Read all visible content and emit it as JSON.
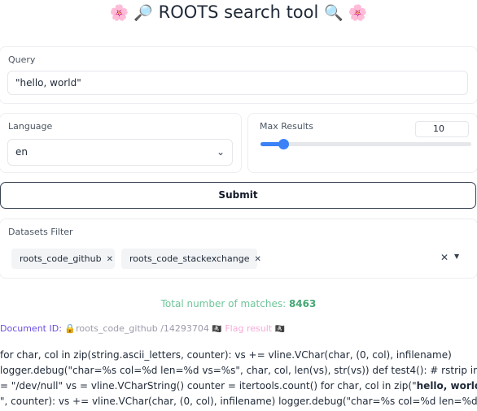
{
  "header": {
    "title": "ROOTS search tool",
    "left_emojis": "🌸 🔎",
    "right_emojis": "🔍 🌸"
  },
  "query": {
    "label": "Query",
    "value": "\"hello, world\""
  },
  "language": {
    "label": "Language",
    "selected": "en"
  },
  "max_results": {
    "label": "Max Results",
    "value": "10",
    "slider_fraction": 0.11
  },
  "submit_label": "Submit",
  "datasets_filter": {
    "label": "Datasets Filter",
    "chips": [
      "roots_code_github",
      "roots_code_stackexchange"
    ]
  },
  "results": {
    "total_label": "Total number of matches:",
    "total_count": "8463",
    "document_id_label": "Document ID:",
    "lock_emoji": "🔒",
    "document_dataset": "roots_code_github",
    "document_number": "/14293704",
    "flag_emoji": "🏴‍☠️",
    "flag_label": "Flag result",
    "snippet_lines": [
      "for char, col in zip(string.ascii_letters, counter): vs += vline.VChar(char, (0, col), infilename)",
      "logger.debug(\"char=%s col=%d len=%d vs=%s\", char, col, len(vs), str(vs)) def test4(): # rstrip infilename",
      "= \"/dev/null\" vs = vline.VCharString() counter = itertools.count() for char, col in zip(\"",
      "\", counter): vs += vline.VChar(char, (0, col), infilename) logger.debug(\"char=%s col=%d len=%d vs=%s\","
    ],
    "snippet_highlight": "hello, world"
  },
  "colors": {
    "accent_blue": "#3b82f6",
    "match_green": "#46a776",
    "doc_purple": "#6d4de1",
    "flag_pink": "#f7a8d8"
  }
}
